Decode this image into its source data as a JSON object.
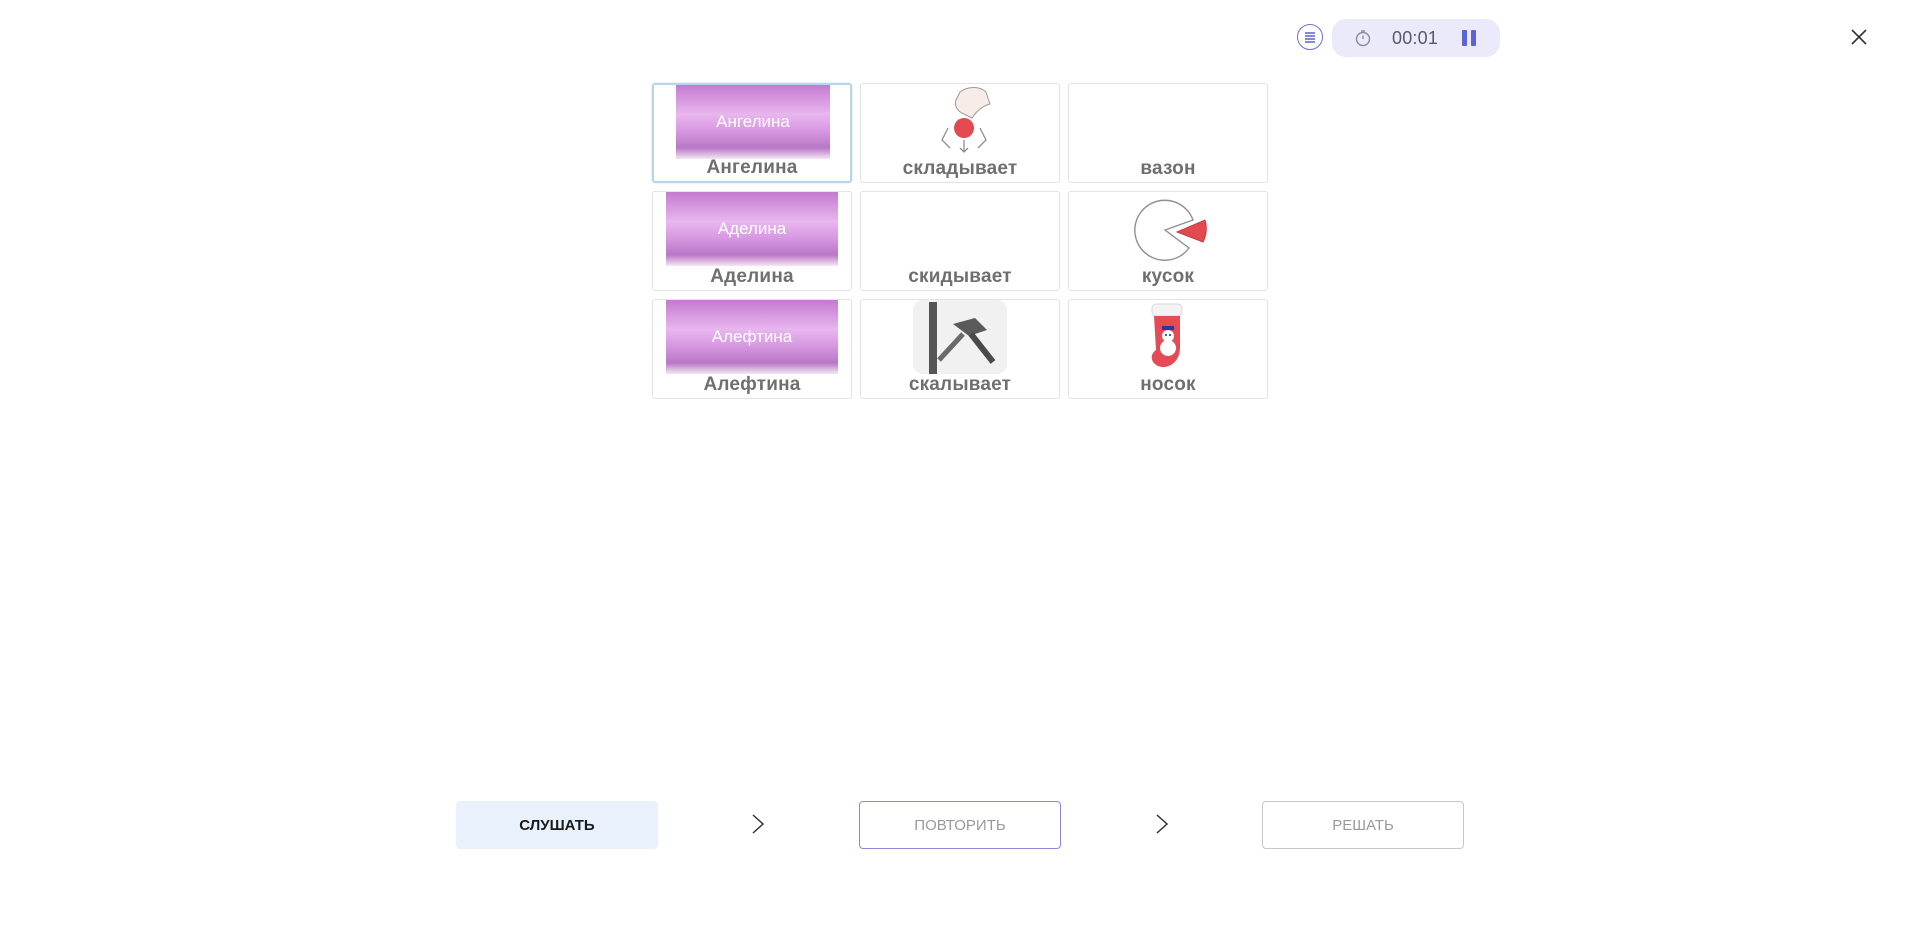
{
  "header": {
    "timer": "00:01",
    "menu_icon": "list-icon",
    "clock_icon": "clock-icon",
    "pause_icon": "pause-icon",
    "close_icon": "close-icon"
  },
  "cards": [
    {
      "label": "Ангелина",
      "image_text": "Ангелина",
      "selected": true
    },
    {
      "label": "складывает",
      "icon": "folding-hand-icon"
    },
    {
      "label": "вазон",
      "icon": ""
    },
    {
      "label": "Аделина",
      "image_text": "Аделина"
    },
    {
      "label": "скидывает",
      "icon": ""
    },
    {
      "label": "кусок",
      "icon": "pie-slice-icon"
    },
    {
      "label": "Алефтина",
      "image_text": "Алефтина"
    },
    {
      "label": "скалывает",
      "icon": "hammer-chisel-icon"
    },
    {
      "label": "носок",
      "icon": "christmas-stocking-icon"
    }
  ],
  "controls": {
    "listen_label": "СЛУШАТЬ",
    "repeat_label": "ПОВТОРИТЬ",
    "solve_label": "РЕШАТЬ"
  },
  "colors": {
    "accent": "#6b6fd6",
    "pill_bg": "#ebeafb",
    "listen_bg": "#e9f1fc",
    "name_gradient": "#d99be3"
  }
}
